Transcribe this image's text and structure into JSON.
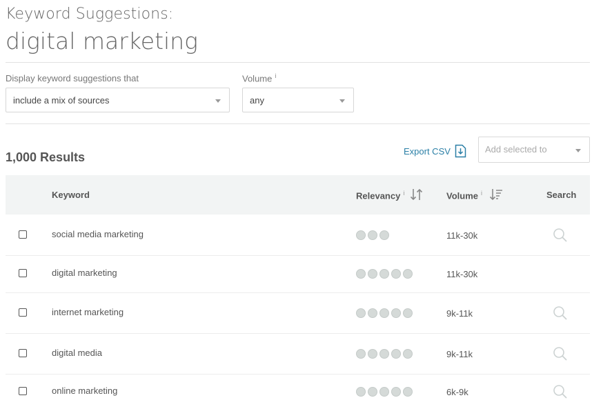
{
  "header": {
    "title_line1": "Keyword Suggestions:",
    "title_line2": "digital marketing"
  },
  "filters": {
    "source_label": "Display keyword suggestions that",
    "source_value": "include a mix of sources",
    "volume_label": "Volume",
    "volume_value": "any",
    "info_marker": "i"
  },
  "toolbar": {
    "results_count": "1,000 Results",
    "export_label": "Export CSV",
    "add_selected_placeholder": "Add selected to"
  },
  "table": {
    "columns": {
      "keyword": "Keyword",
      "relevancy": "Relevancy",
      "volume": "Volume",
      "search": "Search"
    },
    "rows": [
      {
        "keyword": "social media marketing",
        "relevancy_dots": 3,
        "volume": "11k-30k",
        "search_icon": true
      },
      {
        "keyword": "digital marketing",
        "relevancy_dots": 5,
        "volume": "11k-30k",
        "search_icon": false
      },
      {
        "keyword": "internet marketing",
        "relevancy_dots": 5,
        "volume": "9k-11k",
        "search_icon": true
      },
      {
        "keyword": "digital media",
        "relevancy_dots": 5,
        "volume": "9k-11k",
        "search_icon": true
      },
      {
        "keyword": "online marketing",
        "relevancy_dots": 5,
        "volume": "6k-9k",
        "search_icon": true
      }
    ]
  },
  "colors": {
    "accent_link": "#2a7fa6",
    "header_bg": "#f2f4f4",
    "dot_fill": "#d5dad8"
  }
}
